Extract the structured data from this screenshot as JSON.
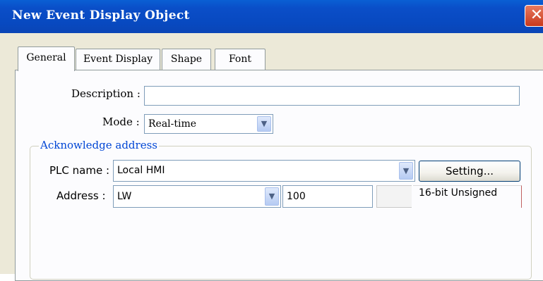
{
  "window": {
    "title": "New  Event Display Object",
    "close_glyph": "✕"
  },
  "tabs": [
    {
      "label": "General",
      "active": true
    },
    {
      "label": "Event Display",
      "active": false
    },
    {
      "label": "Shape",
      "active": false
    },
    {
      "label": "Font",
      "active": false
    }
  ],
  "general": {
    "description_label": "Description :",
    "description_value": "",
    "mode_label": "Mode :",
    "mode_value": "Real-time"
  },
  "acknowledge": {
    "group_title": "Acknowledge address",
    "plc_label": "PLC name :",
    "plc_value": "Local HMI",
    "setting_button": "Setting...",
    "address_label": "Address :",
    "address_type": "LW",
    "address_value": "100",
    "data_format": "16-bit Unsigned"
  },
  "icons": {
    "dropdown": "chevron-down-icon",
    "close": "close-icon"
  },
  "colors": {
    "titlebar": "#0a4ec8",
    "close_button": "#d04a2a",
    "group_title": "#0046d5",
    "dialog_bg": "#ece9d8"
  }
}
